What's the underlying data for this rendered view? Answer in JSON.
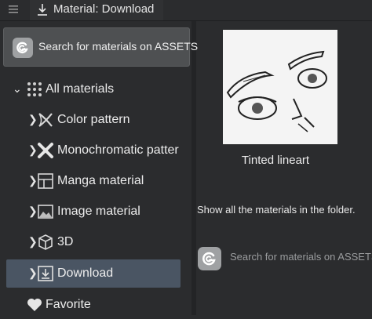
{
  "window": {
    "title": "Material: Download"
  },
  "search_button": {
    "label": "Search for materials on ASSETS"
  },
  "tree": {
    "root": "All materials",
    "items": [
      {
        "label": "Color pattern",
        "icon": "color-pattern-icon"
      },
      {
        "label": "Monochromatic patter",
        "icon": "monochromatic-pattern-icon"
      },
      {
        "label": "Manga material",
        "icon": "manga-material-icon"
      },
      {
        "label": "Image material",
        "icon": "image-material-icon"
      },
      {
        "label": "3D",
        "icon": "cube-icon"
      },
      {
        "label": "Download",
        "icon": "download-icon",
        "selected": true
      }
    ],
    "favorite": "Favorite"
  },
  "preview": {
    "caption": "Tinted lineart",
    "info": "Show all the materials in the folder.",
    "assets_link": "Search for materials on ASSETS"
  },
  "colors": {
    "background": "#2b2c2e",
    "selected": "#4a5563",
    "button": "#4e5052"
  }
}
